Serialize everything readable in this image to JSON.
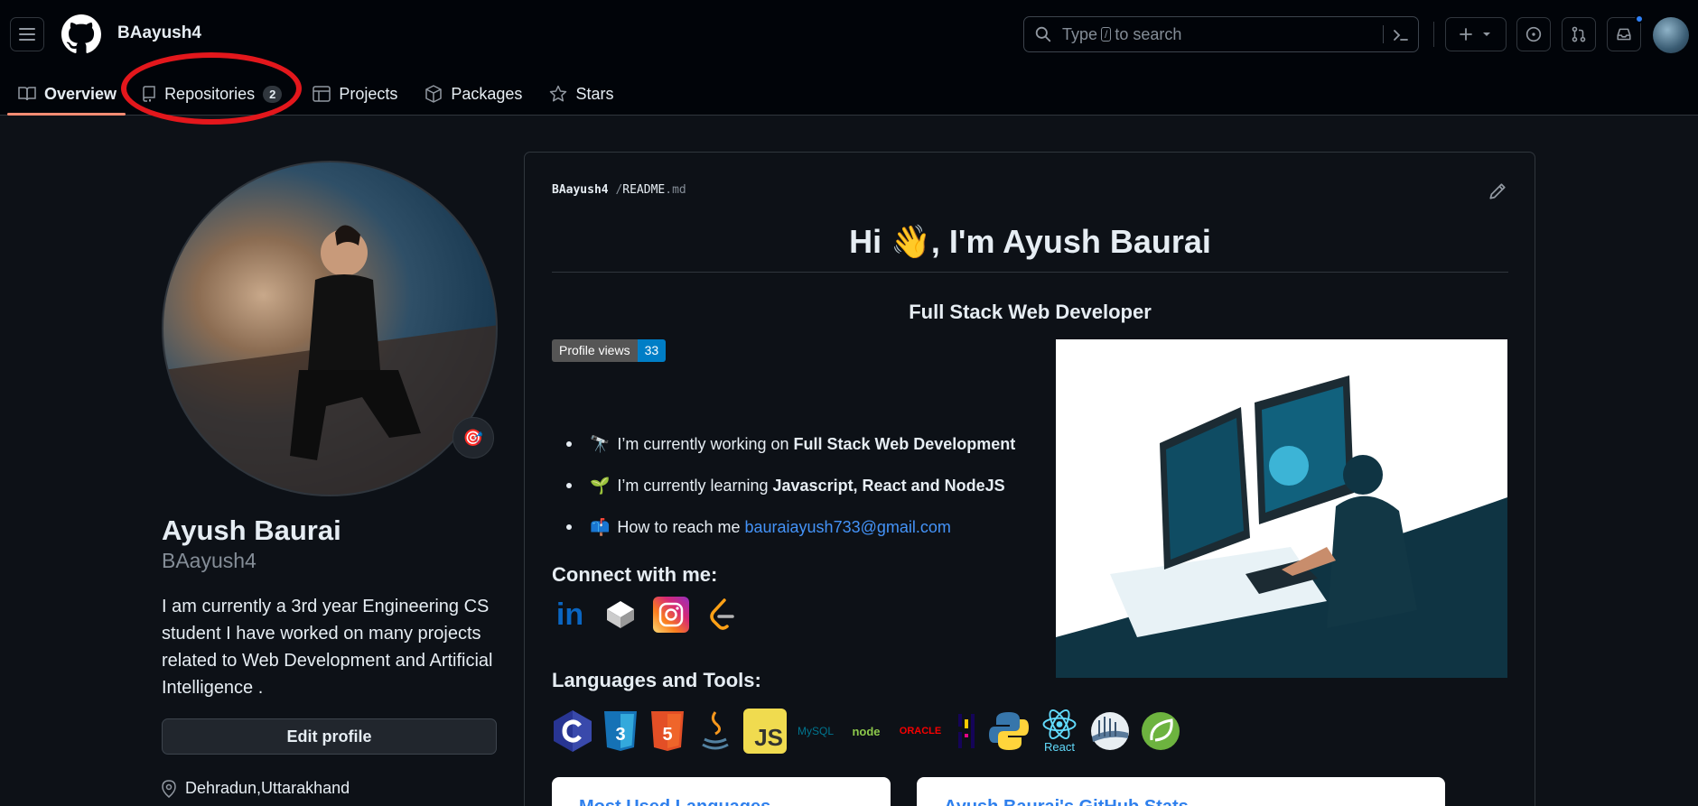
{
  "header": {
    "username": "BAayush4",
    "search": {
      "prefix": "Type",
      "key": "/",
      "suffix": "to search"
    }
  },
  "tabs": [
    {
      "label": "Overview",
      "icon": "book-icon",
      "active": true
    },
    {
      "label": "Repositories",
      "icon": "repo-icon",
      "count": "2"
    },
    {
      "label": "Projects",
      "icon": "table-icon"
    },
    {
      "label": "Packages",
      "icon": "package-icon"
    },
    {
      "label": "Stars",
      "icon": "star-icon"
    }
  ],
  "profile": {
    "name": "Ayush Baurai",
    "login": "BAayush4",
    "bio": "I am currently a 3rd year Engineering CS student I have worked on many projects related to Web Development and Artificial Intelligence .",
    "edit_label": "Edit profile",
    "location": "Dehradun,Uttarakhand",
    "status_emoji": "🎯"
  },
  "readme": {
    "crumb_user": "BAayush4",
    "crumb_sep": "/",
    "crumb_file": "README",
    "crumb_ext": ".md",
    "title": "Hi 👋, I'm Ayush Baurai",
    "subtitle": "Full Stack Web Developer",
    "badge_label": "Profile views",
    "badge_value": "33",
    "bullets": [
      {
        "emoji": "🔭",
        "text": "I’m currently working on",
        "bold": "Full Stack Web Development"
      },
      {
        "emoji": "🌱",
        "text": "I’m currently learning",
        "bold": "Javascript, React and NodeJS"
      },
      {
        "emoji": "📫",
        "text": "How to reach me",
        "link": "bauraiayush733@gmail.com"
      }
    ],
    "connect_heading": "Connect with me:",
    "languages_heading": "Languages and Tools:",
    "social": [
      "linkedin",
      "codepen",
      "instagram",
      "leetcode"
    ],
    "lang_labels": {
      "mysql": "MySQL",
      "node": "node",
      "oracle": "ORACLE",
      "react": "React",
      "js": "JS"
    },
    "cards": [
      "Most Used Languages",
      "Ayush Baurai's GitHub Stats"
    ]
  },
  "colors": {
    "accent_tab": "#fd8c73",
    "link": "#4493f8",
    "annotation": "#e3171c"
  }
}
